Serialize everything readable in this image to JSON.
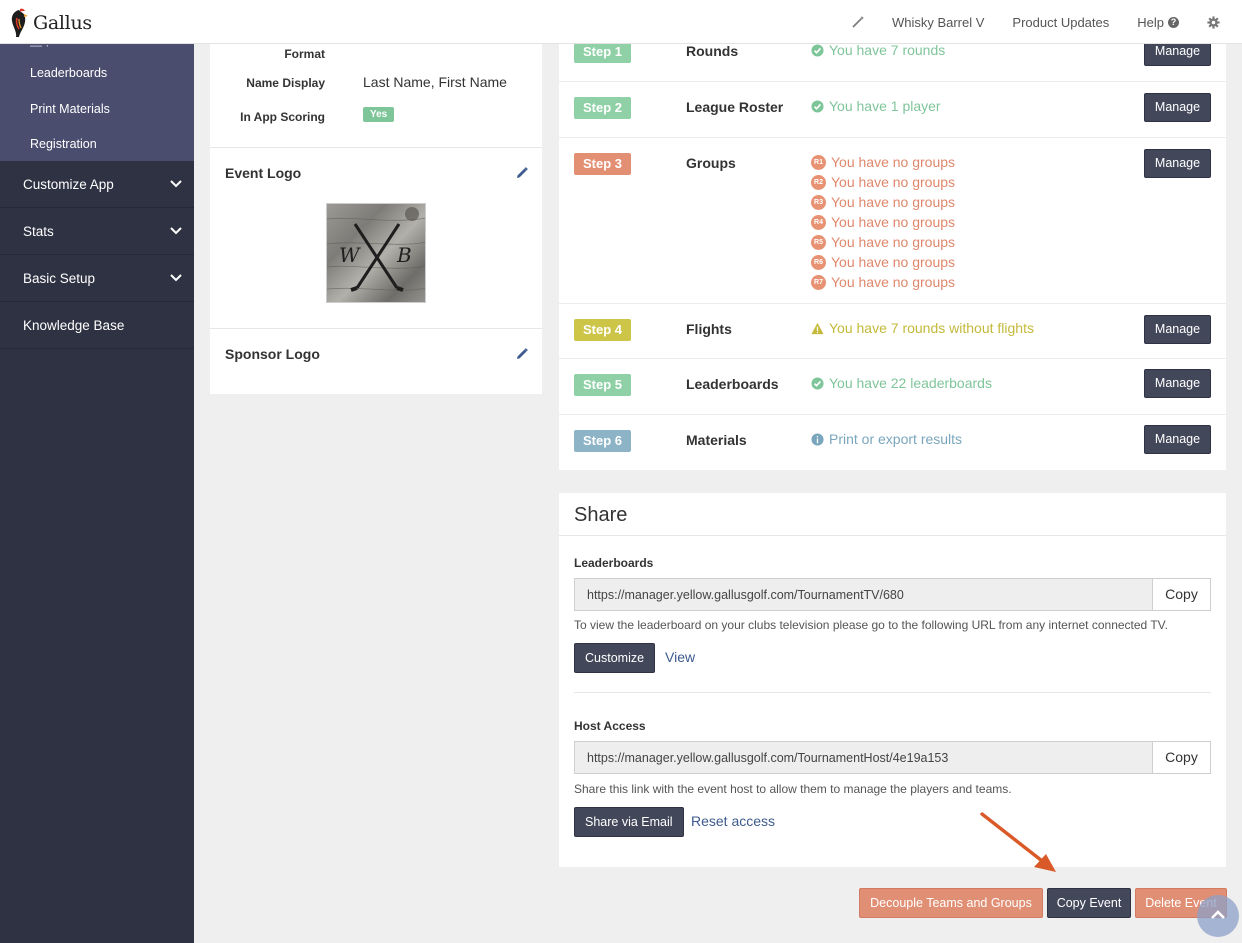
{
  "app": {
    "brand": "Gallus"
  },
  "topnav": {
    "event_name": "Whisky Barrel V",
    "product_updates": "Product Updates",
    "help": "Help"
  },
  "sidebar": {
    "sub_items": [
      "Leaderboards",
      "Print Materials",
      "Registration"
    ],
    "menu": [
      "Customize App",
      "Stats",
      "Basic Setup",
      "Knowledge Base"
    ]
  },
  "details": {
    "format_label": "Format",
    "name_display_label": "Name Display",
    "name_display_value": "Last Name, First Name",
    "in_app_scoring_label": "In App Scoring",
    "in_app_scoring_value": "Yes",
    "event_logo_title": "Event Logo",
    "event_logo_initials": [
      "W",
      "B"
    ],
    "sponsor_logo_title": "Sponsor Logo"
  },
  "steps": [
    {
      "badge": "Step 1",
      "name": "Rounds",
      "status": "You have 7 rounds",
      "color": "#8fd0a6",
      "text_color": "#7fc59a",
      "button": "Manage"
    },
    {
      "badge": "Step 2",
      "name": "League Roster",
      "status": "You have 1 player",
      "color": "#8fd0a6",
      "text_color": "#7fc59a",
      "button": "Manage"
    },
    {
      "badge": "Step 3",
      "name": "Groups",
      "rounds": [
        {
          "tag": "R1",
          "text": "You have no groups"
        },
        {
          "tag": "R2",
          "text": "You have no groups"
        },
        {
          "tag": "R3",
          "text": "You have no groups"
        },
        {
          "tag": "R4",
          "text": "You have no groups"
        },
        {
          "tag": "R5",
          "text": "You have no groups"
        },
        {
          "tag": "R6",
          "text": "You have no groups"
        },
        {
          "tag": "R7",
          "text": "You have no groups"
        }
      ],
      "color": "#e38f74",
      "text_color": "#e0876b",
      "button": "Manage"
    },
    {
      "badge": "Step 4",
      "name": "Flights",
      "status": "You have 7 rounds without flights",
      "color": "#cdc548",
      "text_color": "#c4b93a",
      "button": "Manage"
    },
    {
      "badge": "Step 5",
      "name": "Leaderboards",
      "status": "You have 22 leaderboards",
      "color": "#8fd0a6",
      "text_color": "#7fc59a",
      "button": "Manage"
    },
    {
      "badge": "Step 6",
      "name": "Materials",
      "status": "Print or export results",
      "color": "#8db3c6",
      "text_color": "#7aa6bd",
      "button": "Manage"
    }
  ],
  "share": {
    "title": "Share",
    "leaderboards_label": "Leaderboards",
    "leaderboards_url": "https://manager.yellow.gallusgolf.com/TournamentTV/680",
    "copy": "Copy",
    "leaderboards_help": "To view the leaderboard on your clubs television please go to the following URL from any internet connected TV.",
    "customize": "Customize",
    "view": "View",
    "host_label": "Host Access",
    "host_url": "https://manager.yellow.gallusgolf.com/TournamentHost/4e19a153",
    "host_help": "Share this link with the event host to allow them to manage the players and teams.",
    "share_email": "Share via Email",
    "reset_access": "Reset access"
  },
  "actions": {
    "decouple": "Decouple Teams and Groups",
    "copy_event": "Copy Event",
    "delete_event": "Delete Event"
  },
  "colors": {
    "sidebar": "#2f3243",
    "sidebar_sub": "#4b4d6e",
    "dark_button": "#43475a",
    "salmon_button": "#e18f74",
    "arrow": "#d95a28"
  }
}
